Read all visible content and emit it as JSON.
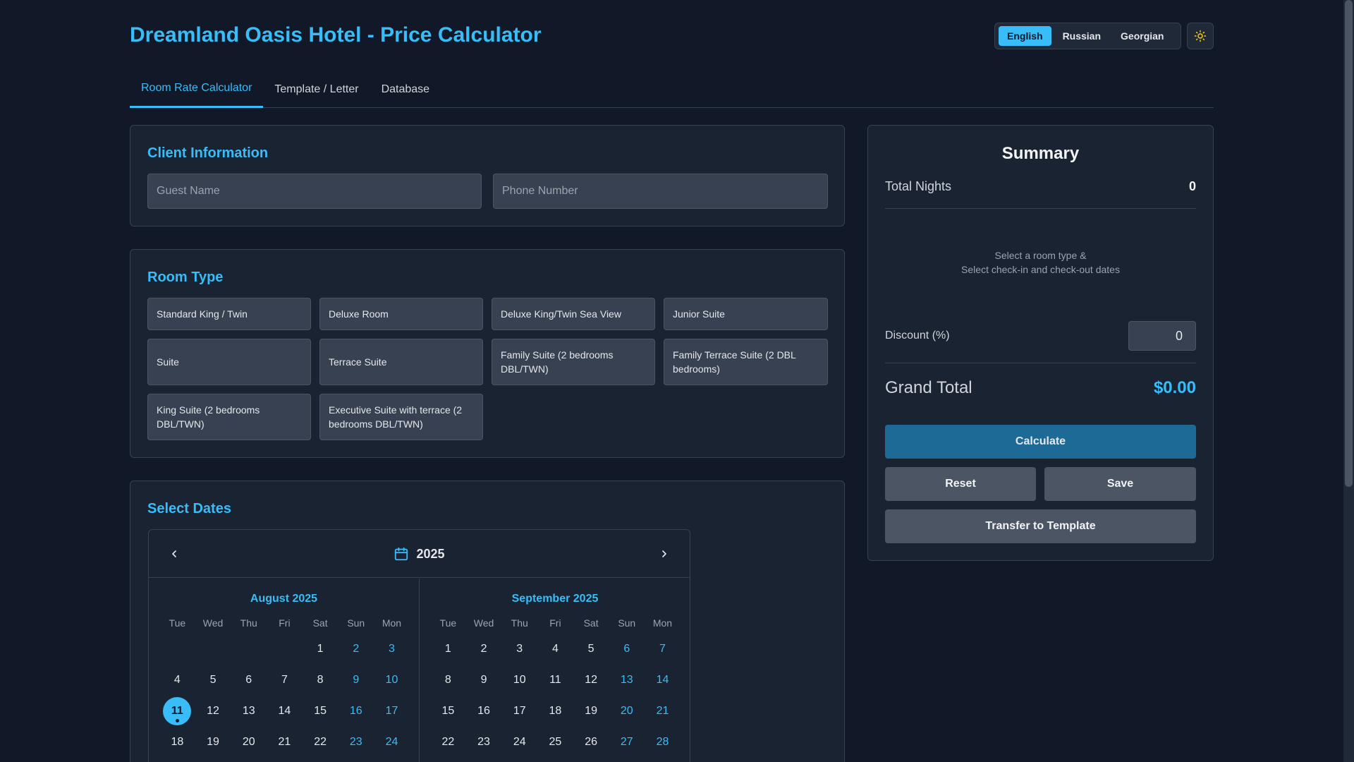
{
  "header": {
    "title": "Dreamland Oasis Hotel - Price Calculator",
    "languages": [
      "English",
      "Russian",
      "Georgian"
    ],
    "active_language": "English",
    "theme_icon": "sun-icon"
  },
  "tabs": [
    {
      "label": "Room Rate Calculator",
      "active": true
    },
    {
      "label": "Template / Letter",
      "active": false
    },
    {
      "label": "Database",
      "active": false
    }
  ],
  "client": {
    "title": "Client Information",
    "guest_placeholder": "Guest Name",
    "phone_placeholder": "Phone Number"
  },
  "rooms": {
    "title": "Room Type",
    "items": [
      "Standard King / Twin",
      "Deluxe Room",
      "Deluxe King/Twin Sea View",
      "Junior Suite",
      "Suite",
      "Terrace Suite",
      "Family Suite (2 bedrooms DBL/TWN)",
      "Family Terrace Suite (2 DBL bedrooms)",
      "King Suite (2 bedrooms DBL/TWN)",
      "Executive Suite with terrace (2 bedrooms DBL/TWN)"
    ]
  },
  "dates": {
    "title": "Select Dates",
    "year": "2025",
    "weekdays": [
      "Tue",
      "Wed",
      "Thu",
      "Fri",
      "Sat",
      "Sun",
      "Mon"
    ],
    "months": [
      {
        "name": "August 2025",
        "rows": [
          [
            "",
            "",
            "",
            "",
            "1",
            "2",
            "3"
          ],
          [
            "4",
            "5",
            "6",
            "7",
            "8",
            "9",
            "10"
          ],
          [
            "11",
            "12",
            "13",
            "14",
            "15",
            "16",
            "17"
          ],
          [
            "18",
            "19",
            "20",
            "21",
            "22",
            "23",
            "24"
          ]
        ],
        "today": "11"
      },
      {
        "name": "September 2025",
        "rows": [
          [
            "1",
            "2",
            "3",
            "4",
            "5",
            "6",
            "7"
          ],
          [
            "8",
            "9",
            "10",
            "11",
            "12",
            "13",
            "14"
          ],
          [
            "15",
            "16",
            "17",
            "18",
            "19",
            "20",
            "21"
          ],
          [
            "22",
            "23",
            "24",
            "25",
            "26",
            "27",
            "28"
          ]
        ],
        "today": ""
      }
    ]
  },
  "summary": {
    "title": "Summary",
    "total_nights_label": "Total Nights",
    "total_nights_value": "0",
    "hint_line1": "Select a room type &",
    "hint_line2": "Select check-in and check-out dates",
    "discount_label": "Discount (%)",
    "discount_value": "0",
    "grand_total_label": "Grand Total",
    "grand_total_value": "$0.00",
    "calculate_label": "Calculate",
    "reset_label": "Reset",
    "save_label": "Save",
    "transfer_label": "Transfer to Template"
  }
}
